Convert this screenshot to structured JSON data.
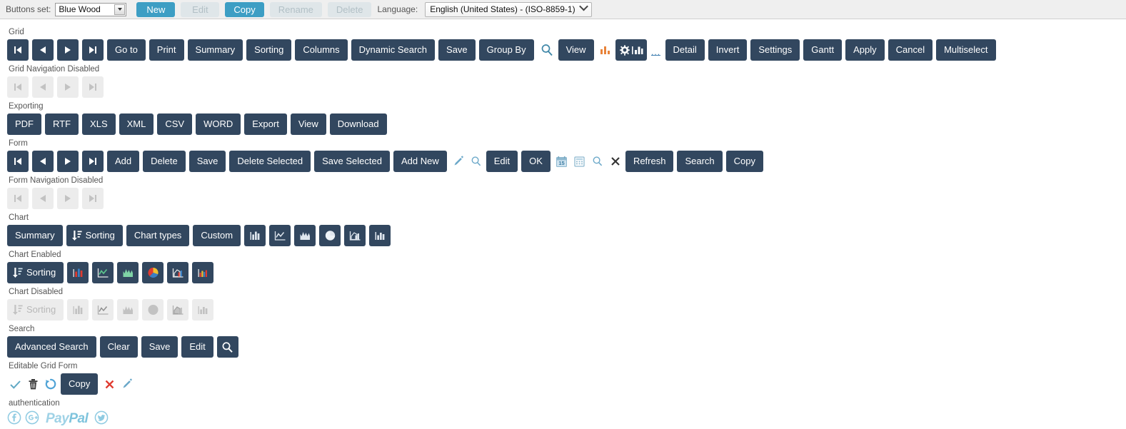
{
  "topbar": {
    "buttons_set_label": "Buttons set:",
    "buttons_set_value": "Blue Wood",
    "new_label": "New",
    "edit_label": "Edit",
    "copy_label": "Copy",
    "rename_label": "Rename",
    "delete_label": "Delete",
    "language_label": "Language:",
    "language_value": "English (United States) - (ISO-8859-1)"
  },
  "sections": {
    "grid": {
      "label": "Grid",
      "buttons": [
        "Go to",
        "Print",
        "Summary",
        "Sorting",
        "Columns",
        "Dynamic Search",
        "Save",
        "Group By",
        "View",
        "Detail",
        "Invert",
        "Settings",
        "Gantt",
        "Apply",
        "Cancel",
        "Multiselect"
      ],
      "nav": [
        "first-page",
        "previous-page",
        "next-page",
        "last-page"
      ],
      "icons": [
        "search-icon",
        "bar-chart-orange-icon",
        "gear-chart-icon",
        "ellipsis-icon"
      ]
    },
    "grid_nav_disabled": {
      "label": "Grid Navigation Disabled",
      "nav": [
        "first-page",
        "previous-page",
        "next-page",
        "last-page"
      ]
    },
    "exporting": {
      "label": "Exporting",
      "buttons": [
        "PDF",
        "RTF",
        "XLS",
        "XML",
        "CSV",
        "WORD",
        "Export",
        "View",
        "Download"
      ]
    },
    "form": {
      "label": "Form",
      "nav": [
        "first-record",
        "previous-record",
        "next-record",
        "last-record"
      ],
      "buttons": [
        "Add",
        "Delete",
        "Save",
        "Delete Selected",
        "Save Selected",
        "Add New",
        "Edit",
        "OK",
        "Refresh",
        "Search",
        "Copy"
      ],
      "icons": [
        "pencil-icon",
        "magnifier-icon",
        "calendar-icon",
        "calculator-icon",
        "magnifier-icon",
        "close-icon"
      ],
      "calendar_day": "15"
    },
    "form_nav_disabled": {
      "label": "Form Navigation Disabled",
      "nav": [
        "first-record",
        "previous-record",
        "next-record",
        "last-record"
      ]
    },
    "chart": {
      "label": "Chart",
      "buttons": [
        "Summary",
        "Sorting",
        "Chart types",
        "Custom"
      ],
      "chart_icons": [
        "bar-chart-icon",
        "line-chart-icon",
        "area-chart-icon",
        "pie-chart-icon",
        "area-bar-chart-icon",
        "column-chart-icon"
      ]
    },
    "chart_enabled": {
      "label": "Chart Enabled",
      "sorting_label": "Sorting",
      "chart_icons": [
        "bar-chart-icon",
        "line-chart-icon",
        "area-chart-icon",
        "pie-chart-icon",
        "area-bar-chart-icon",
        "column-chart-icon"
      ]
    },
    "chart_disabled": {
      "label": "Chart Disabled",
      "sorting_label": "Sorting",
      "chart_icons": [
        "bar-chart-icon",
        "line-chart-icon",
        "area-chart-icon",
        "pie-chart-icon",
        "area-bar-chart-icon",
        "column-chart-icon"
      ]
    },
    "search": {
      "label": "Search",
      "buttons": [
        "Advanced Search",
        "Clear",
        "Save",
        "Edit"
      ],
      "icons": [
        "search-icon"
      ]
    },
    "editable_grid_form": {
      "label": "Editable Grid Form",
      "copy_label": "Copy",
      "icons": [
        "check-icon",
        "trash-icon",
        "refresh-icon",
        "close-icon",
        "pencil-icon"
      ]
    },
    "authentication": {
      "label": "authentication",
      "icons": [
        "facebook-icon",
        "google-plus-icon",
        "paypal-logo",
        "twitter-icon"
      ],
      "paypal_pay": "Pay",
      "paypal_pal": "Pal"
    }
  },
  "colors": {
    "navy": "#32475f",
    "teal": "#3d9ec4",
    "disabled_bg": "#ececec",
    "topbar_bg": "#efefef",
    "accent_blue": "#7fc4dd",
    "orange": "#e8833a",
    "red": "#e03b30",
    "green": "#5cc48c"
  }
}
